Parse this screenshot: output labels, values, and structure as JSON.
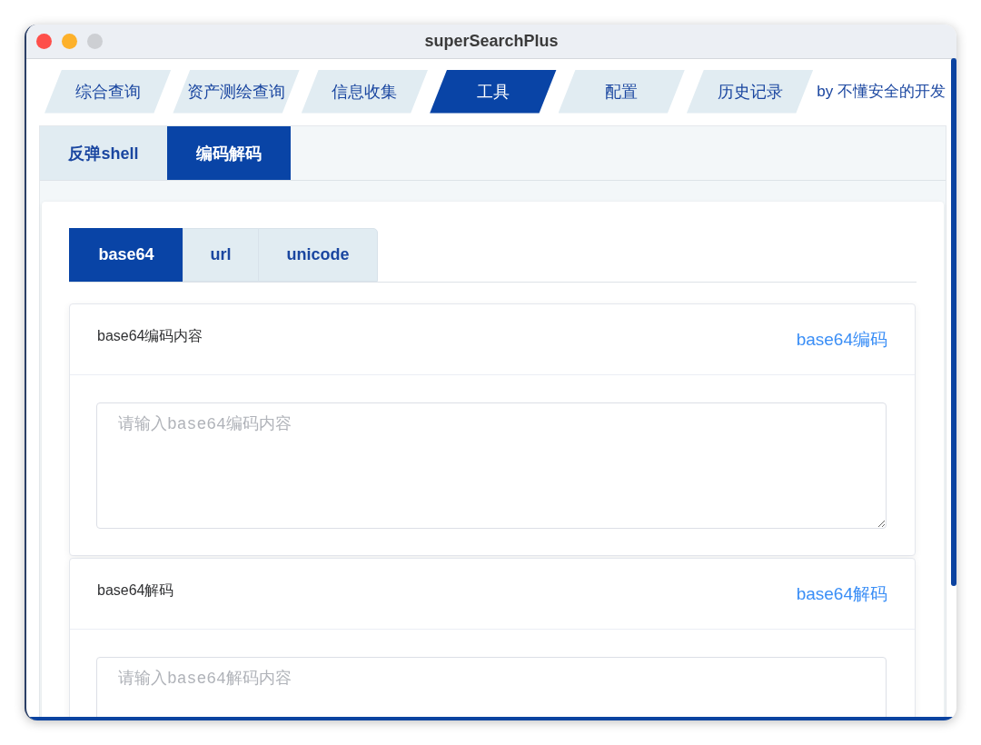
{
  "window": {
    "title": "superSearchPlus"
  },
  "main_tabs": [
    {
      "label": "综合查询",
      "selected": false
    },
    {
      "label": "资产测绘查询",
      "selected": false
    },
    {
      "label": "信息收集",
      "selected": false
    },
    {
      "label": "工具",
      "selected": true
    },
    {
      "label": "配置",
      "selected": false
    },
    {
      "label": "历史记录",
      "selected": false
    }
  ],
  "credit": "by 不懂安全的开发",
  "tool_tabs": [
    {
      "label": "反弹shell",
      "selected": false
    },
    {
      "label": "编码解码",
      "selected": true
    }
  ],
  "codec_tabs": [
    {
      "label": "base64",
      "selected": true
    },
    {
      "label": "url",
      "selected": false
    },
    {
      "label": "unicode",
      "selected": false
    }
  ],
  "sections": [
    {
      "title": "base64编码内容",
      "action": "base64编码",
      "placeholder": "请输入base64编码内容"
    },
    {
      "title": "base64解码",
      "action": "base64解码",
      "placeholder": "请输入base64解码内容"
    }
  ]
}
